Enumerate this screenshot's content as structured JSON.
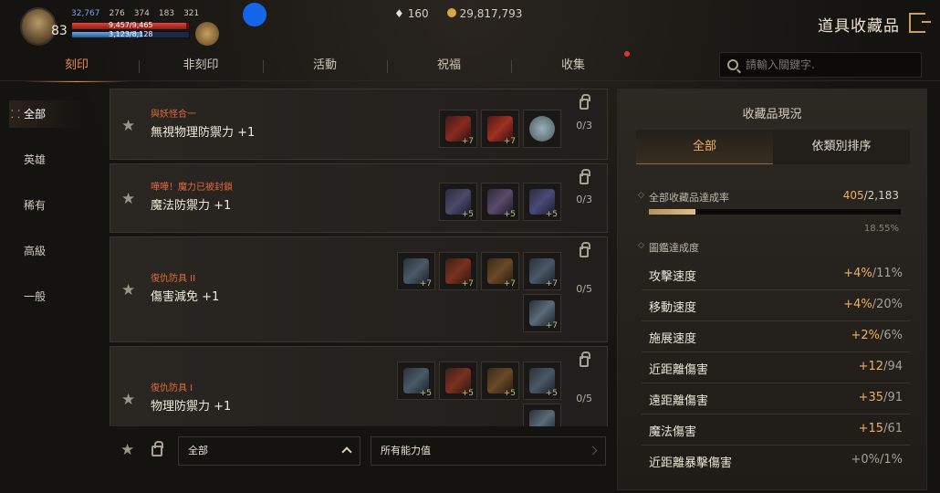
{
  "player": {
    "level": "83",
    "power": "32,767",
    "stat1": "276",
    "stat2": "374",
    "stat3": "183",
    "stat4": "321",
    "hp": "9,457/9,465",
    "mp": "3,123/8,128"
  },
  "currency": {
    "gems": "160",
    "gold": "29,817,793"
  },
  "title": "道具收藏品",
  "tabs": [
    "刻印",
    "非刻印",
    "活動",
    "祝福",
    "收集"
  ],
  "search": {
    "placeholder": "請輸入關鍵字."
  },
  "leftnav": [
    "全部",
    "英雄",
    "稀有",
    "高級",
    "一般"
  ],
  "cards": [
    {
      "subtitle": "與妖怪合一",
      "name": "無視物理防禦力 +1",
      "count": "0/3",
      "pluses": [
        "+7",
        "+7",
        ""
      ]
    },
    {
      "subtitle": "嘩嘩！魔力已被封鎖",
      "name": "魔法防禦力 +1",
      "count": "0/3",
      "pluses": [
        "+5",
        "+5",
        "+5"
      ]
    },
    {
      "subtitle": "復仇防具 II",
      "name": "傷害減免 +1",
      "count": "0/5",
      "pluses": [
        "+7",
        "+7",
        "+7",
        "+7",
        "+7"
      ]
    },
    {
      "subtitle": "復仇防具 I",
      "name": "物理防禦力 +1",
      "count": "0/5",
      "pluses": [
        "+5",
        "+5",
        "+5",
        "+5",
        ""
      ]
    }
  ],
  "filters": {
    "category": "全部",
    "ability": "所有能力值"
  },
  "panel": {
    "title": "收藏品現況",
    "tabs": [
      "全部",
      "依類別排序"
    ],
    "achievement_label": "全部收藏品達成率",
    "achieved": "405",
    "total": "/2,183",
    "percent": "18.55%",
    "percent_value": 18.55,
    "codex_label": "圖鑑達成度",
    "stats": [
      {
        "label": "攻擊速度",
        "cur": "+4%",
        "max": "/11%"
      },
      {
        "label": "移動速度",
        "cur": "+4%",
        "max": "/20%"
      },
      {
        "label": "施展速度",
        "cur": "+2%",
        "max": "/6%"
      },
      {
        "label": "近距離傷害",
        "cur": "+12",
        "max": "/94"
      },
      {
        "label": "遠距離傷害",
        "cur": "+35",
        "max": "/91"
      },
      {
        "label": "魔法傷害",
        "cur": "+15",
        "max": "/61"
      },
      {
        "label": "近距離暴擊傷害",
        "cur": "+0%",
        "max": "/1%"
      }
    ]
  }
}
